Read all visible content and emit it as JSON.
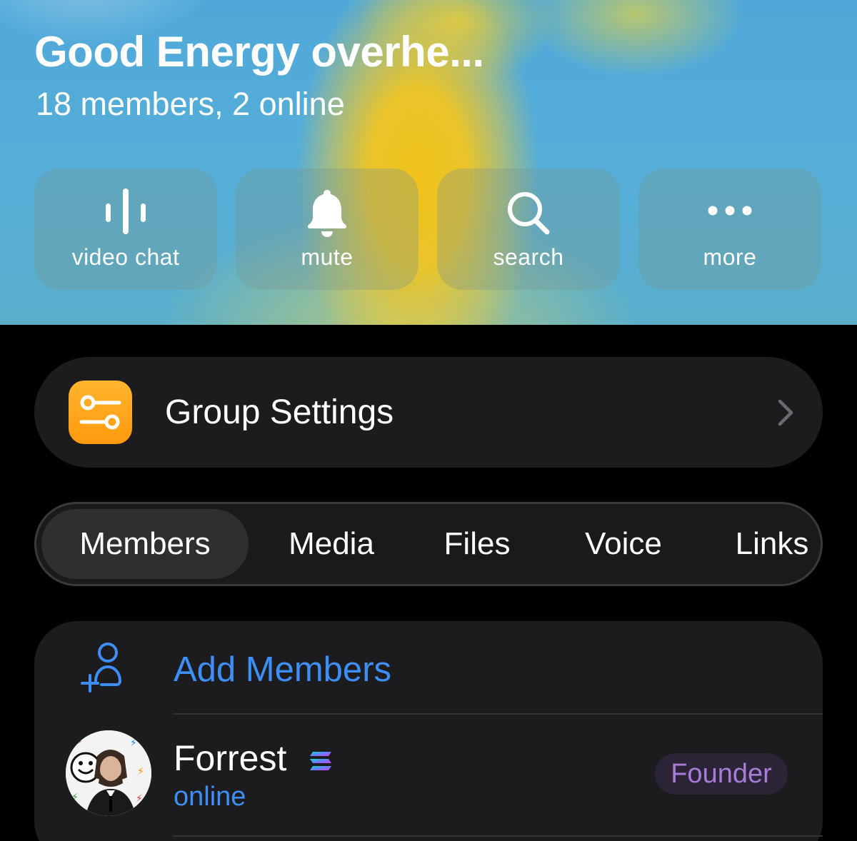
{
  "header": {
    "title": "Good Energy overhe...",
    "subtitle": "18 members, 2 online",
    "actions": [
      {
        "label": "video chat",
        "icon": "voice-chat-icon"
      },
      {
        "label": "mute",
        "icon": "bell-icon"
      },
      {
        "label": "search",
        "icon": "search-icon"
      },
      {
        "label": "more",
        "icon": "more-dots-icon"
      }
    ]
  },
  "settings": {
    "label": "Group Settings",
    "icon": "sliders-icon",
    "icon_color": "#ff9f0a"
  },
  "tabs": [
    {
      "label": "Members",
      "active": true
    },
    {
      "label": "Media",
      "active": false
    },
    {
      "label": "Files",
      "active": false
    },
    {
      "label": "Voice",
      "active": false
    },
    {
      "label": "Links",
      "active": false
    }
  ],
  "members": {
    "add_label": "Add Members",
    "accent_color": "#3e8ef7",
    "list": [
      {
        "name": "Forrest",
        "status": "online",
        "badge": "Founder",
        "emoji_status": "solana-icon"
      }
    ]
  }
}
